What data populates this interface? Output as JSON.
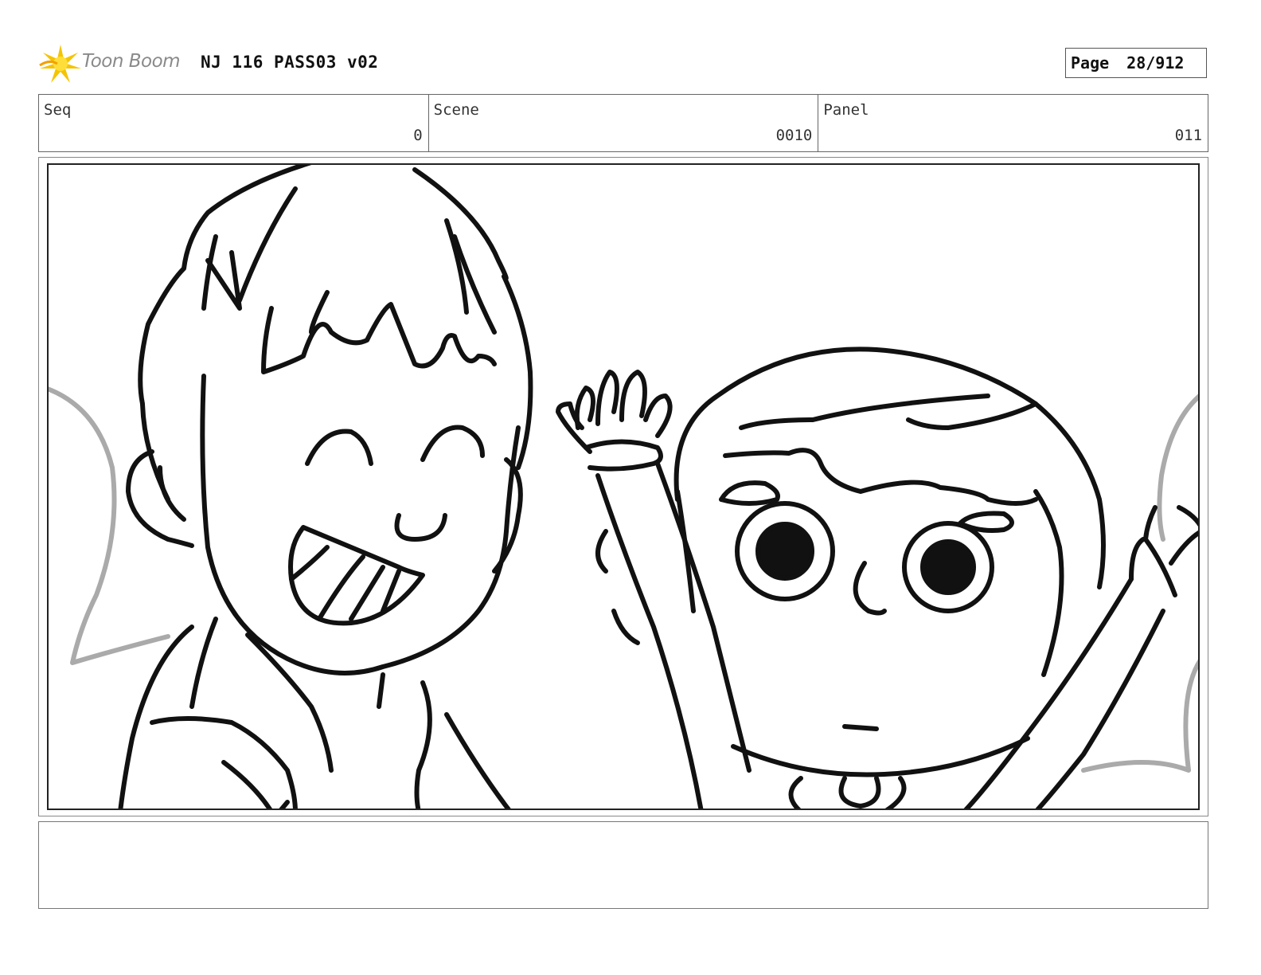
{
  "header": {
    "logo_text": "Toon Boom",
    "title": "NJ 116 PASS03 v02",
    "page_label": "Page",
    "page_number": "28/912"
  },
  "meta": {
    "seq_label": "Seq",
    "seq_value": "0",
    "scene_label": "Scene",
    "scene_value": "0010",
    "panel_label": "Panel",
    "panel_value": "011"
  },
  "panel": {
    "image_subject": "storyboard-sketch-two-kids-waving",
    "line_color": "#111111",
    "guide_color": "#aaaaaa"
  },
  "notes": {
    "text": ""
  },
  "colors": {
    "logo_star": "#f5c400",
    "logo_text": "#8a8a8a"
  }
}
